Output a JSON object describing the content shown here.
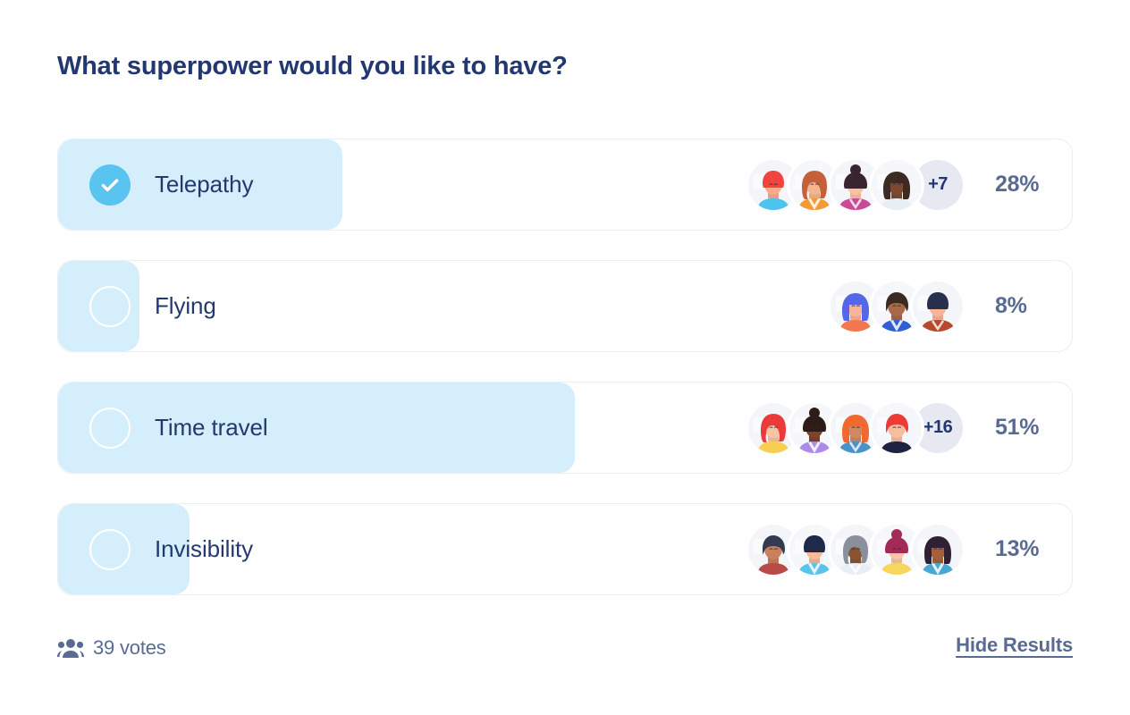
{
  "poll": {
    "title": "What superpower would you like to have?",
    "options": [
      {
        "label": "Telepathy",
        "percent": "28%",
        "percent_value": 28,
        "selected": true,
        "radio_icon": "check-circle-icon",
        "avatar_count": 4,
        "more_label": "+7",
        "has_more": true
      },
      {
        "label": "Flying",
        "percent": "8%",
        "percent_value": 8,
        "selected": false,
        "radio_icon": "radio-empty-icon",
        "avatar_count": 3,
        "more_label": "",
        "has_more": false
      },
      {
        "label": "Time travel",
        "percent": "51%",
        "percent_value": 51,
        "selected": false,
        "radio_icon": "radio-empty-icon",
        "avatar_count": 4,
        "more_label": "+16",
        "has_more": true
      },
      {
        "label": "Invisibility",
        "percent": "13%",
        "percent_value": 13,
        "selected": false,
        "radio_icon": "radio-empty-icon",
        "avatar_count": 5,
        "more_label": "",
        "has_more": false
      }
    ],
    "footer": {
      "votes_icon": "people-group-icon",
      "votes_text": "39 votes",
      "hide_results_label": "Hide Results"
    },
    "colors": {
      "title": "#23386e",
      "bar_fill": "#d4eefb",
      "selected_radio": "#58c4ef",
      "percent_text": "#5a6b93",
      "badge_bg": "#e6e9f2",
      "row_border": "#e9edf4"
    }
  },
  "avatar_palettes": [
    [
      {
        "hair": "#f0443f",
        "skin": "#f8ab89",
        "shirt": "#4fc3f0",
        "bg": "#f3f5f9"
      },
      {
        "hair": "#c4603a",
        "skin": "#f5b68f",
        "shirt": "#f29a33",
        "bg": "#f6f7fa"
      },
      {
        "hair": "#3a2430",
        "skin": "#f9c3a3",
        "shirt": "#c94b96",
        "bg": "#f3f5f9"
      },
      {
        "hair": "#3b2b22",
        "skin": "#7d4a31",
        "shirt": "#e8eef5",
        "bg": "#f6f7fa"
      }
    ],
    [
      {
        "hair": "#5566e8",
        "skin": "#f7b49a",
        "shirt": "#f2784f",
        "bg": "#f3f5f9"
      },
      {
        "hair": "#3c2a21",
        "skin": "#a9684a",
        "shirt": "#2f5fd0",
        "bg": "#f6f7fa"
      },
      {
        "hair": "#27304d",
        "skin": "#f7b498",
        "shirt": "#b54a2e",
        "bg": "#f3f5f9"
      }
    ],
    [
      {
        "hair": "#ea3a3a",
        "skin": "#f7c4a4",
        "shirt": "#f6cf52",
        "bg": "#f3f5f9"
      },
      {
        "hair": "#2d1c18",
        "skin": "#7c4529",
        "shirt": "#ab8ae8",
        "bg": "#f6f7fa"
      },
      {
        "hair": "#f2692f",
        "skin": "#d08a63",
        "shirt": "#4a93c6",
        "bg": "#f3f5f9"
      },
      {
        "hair": "#ec3a37",
        "skin": "#f7bda0",
        "shirt": "#1d2340",
        "bg": "#f6f7fa"
      }
    ],
    [
      {
        "hair": "#343a52",
        "skin": "#c9805b",
        "shirt": "#b84a47",
        "bg": "#f3f5f9"
      },
      {
        "hair": "#1f2a4a",
        "skin": "#f7b99c",
        "shirt": "#5ac3ea",
        "bg": "#f6f7fa"
      },
      {
        "hair": "#8a8f9c",
        "skin": "#8a5433",
        "shirt": "#e8eef5",
        "bg": "#f3f5f9"
      },
      {
        "hair": "#a32a55",
        "skin": "#f8c6a6",
        "shirt": "#f6d65c",
        "bg": "#f6f7fa"
      },
      {
        "hair": "#2f2133",
        "skin": "#a8603a",
        "shirt": "#4aa6d4",
        "bg": "#f3f5f9"
      }
    ]
  ]
}
